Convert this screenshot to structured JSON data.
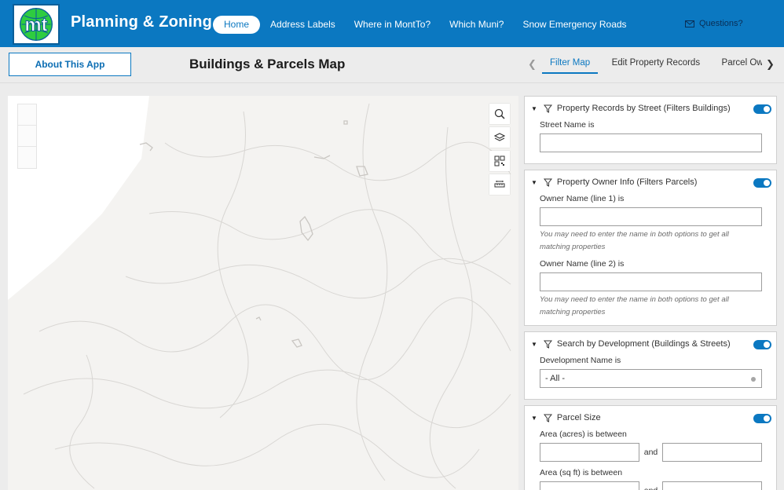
{
  "header": {
    "title": "Planning & Zoning",
    "nav": [
      "Home",
      "Address Labels",
      "Where in MontTo?",
      "Which Muni?",
      "Snow Emergency Roads"
    ],
    "active_nav": "Home",
    "questions_label": "Questions?",
    "brand_color": "#0b78c1"
  },
  "subheader": {
    "about_label": "About This App",
    "page_title": "Buildings & Parcels Map",
    "tabs": [
      "Filter Map",
      "Edit Property Records",
      "Parcel Owner"
    ],
    "active_tab": "Filter Map"
  },
  "filters": {
    "street": {
      "title": "Property Records by Street (Filters Buildings)",
      "field_label": "Street Name is",
      "value": ""
    },
    "owner": {
      "title": "Property Owner Info (Filters Parcels)",
      "line1_label": "Owner Name (line 1) is",
      "line1_hint": "You may need to enter the name in both options to get all matching properties",
      "line2_label": "Owner Name (line 2) is",
      "line2_hint": "You may need to enter the name in both options to get all matching properties"
    },
    "development": {
      "title": "Search by Development (Buildings & Streets)",
      "field_label": "Development Name is",
      "selected": "- All -"
    },
    "parcel_size": {
      "title": "Parcel Size",
      "acres_label": "Area (acres) is between",
      "and_label": "and",
      "sqft_label": "Area (sq ft) is between"
    }
  },
  "icons": {
    "logo": "mt-logo",
    "map_tools": [
      "search-icon",
      "layers-icon",
      "qr-code-icon",
      "measure-icon"
    ],
    "toggle_state": "on"
  }
}
